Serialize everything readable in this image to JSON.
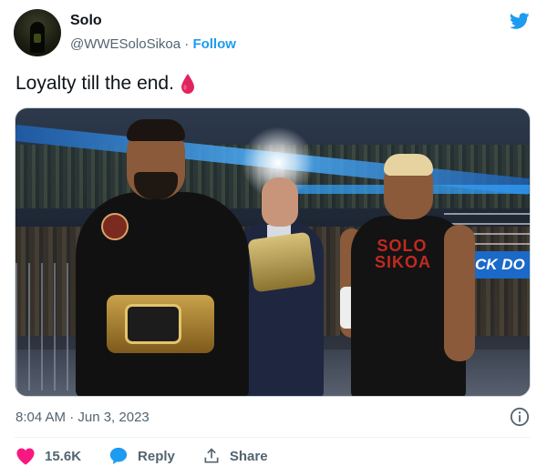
{
  "author": {
    "name": "Solo",
    "handle": "@WWESoloSikoa",
    "separator": "·",
    "follow_label": "Follow"
  },
  "tweet": {
    "text": "Loyalty till the end."
  },
  "media": {
    "banner_text": "CK DO",
    "shirt_text": "SOLO SIKOA"
  },
  "meta": {
    "timestamp": "8:04 AM · Jun 3, 2023"
  },
  "actions": {
    "likes": "15.6K",
    "reply_label": "Reply",
    "share_label": "Share"
  },
  "colors": {
    "accent": "#1d9bf0",
    "like": "#f91880",
    "drop": "#e0245e"
  },
  "icons": [
    "twitter-bird-icon",
    "blood-drop-icon",
    "info-icon",
    "heart-icon",
    "reply-icon",
    "share-icon"
  ]
}
